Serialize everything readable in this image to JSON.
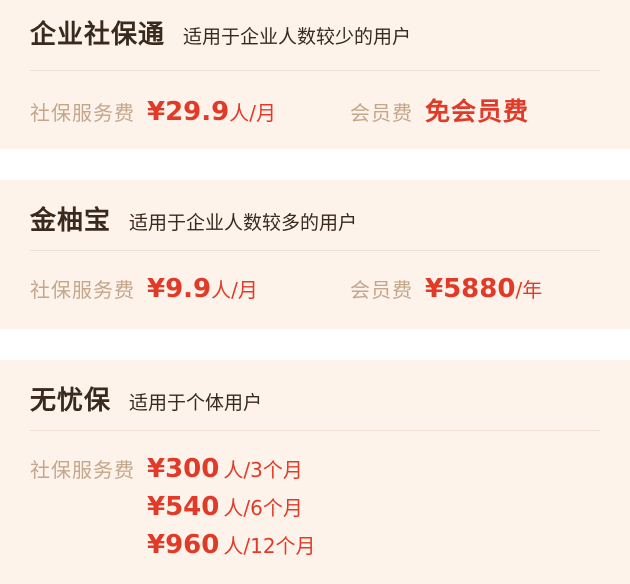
{
  "plans": [
    {
      "name": "企业社保通",
      "desc": "适用于企业人数较少的用户",
      "service_label": "社保服务费",
      "service_price": "¥29.9",
      "service_unit": "人/月",
      "member_label": "会员费",
      "member_value": "免会员费"
    },
    {
      "name": "金柚宝",
      "desc": "适用于企业人数较多的用户",
      "service_label": "社保服务费",
      "service_price": "¥9.9",
      "service_unit": "人/月",
      "member_label": "会员费",
      "member_price": "¥5880",
      "member_unit": "/年"
    },
    {
      "name": "无忧保",
      "desc": "适用于个体用户",
      "service_label": "社保服务费",
      "tiers": [
        {
          "price": "¥300",
          "unit": "人/3个月"
        },
        {
          "price": "¥540",
          "unit": "人/6个月"
        },
        {
          "price": "¥960",
          "unit": "人/12个月"
        }
      ]
    }
  ],
  "colors": {
    "card_bg": "#fdf3ea",
    "title": "#3a2a1e",
    "label": "#c4a68b",
    "price": "#e23a28"
  }
}
